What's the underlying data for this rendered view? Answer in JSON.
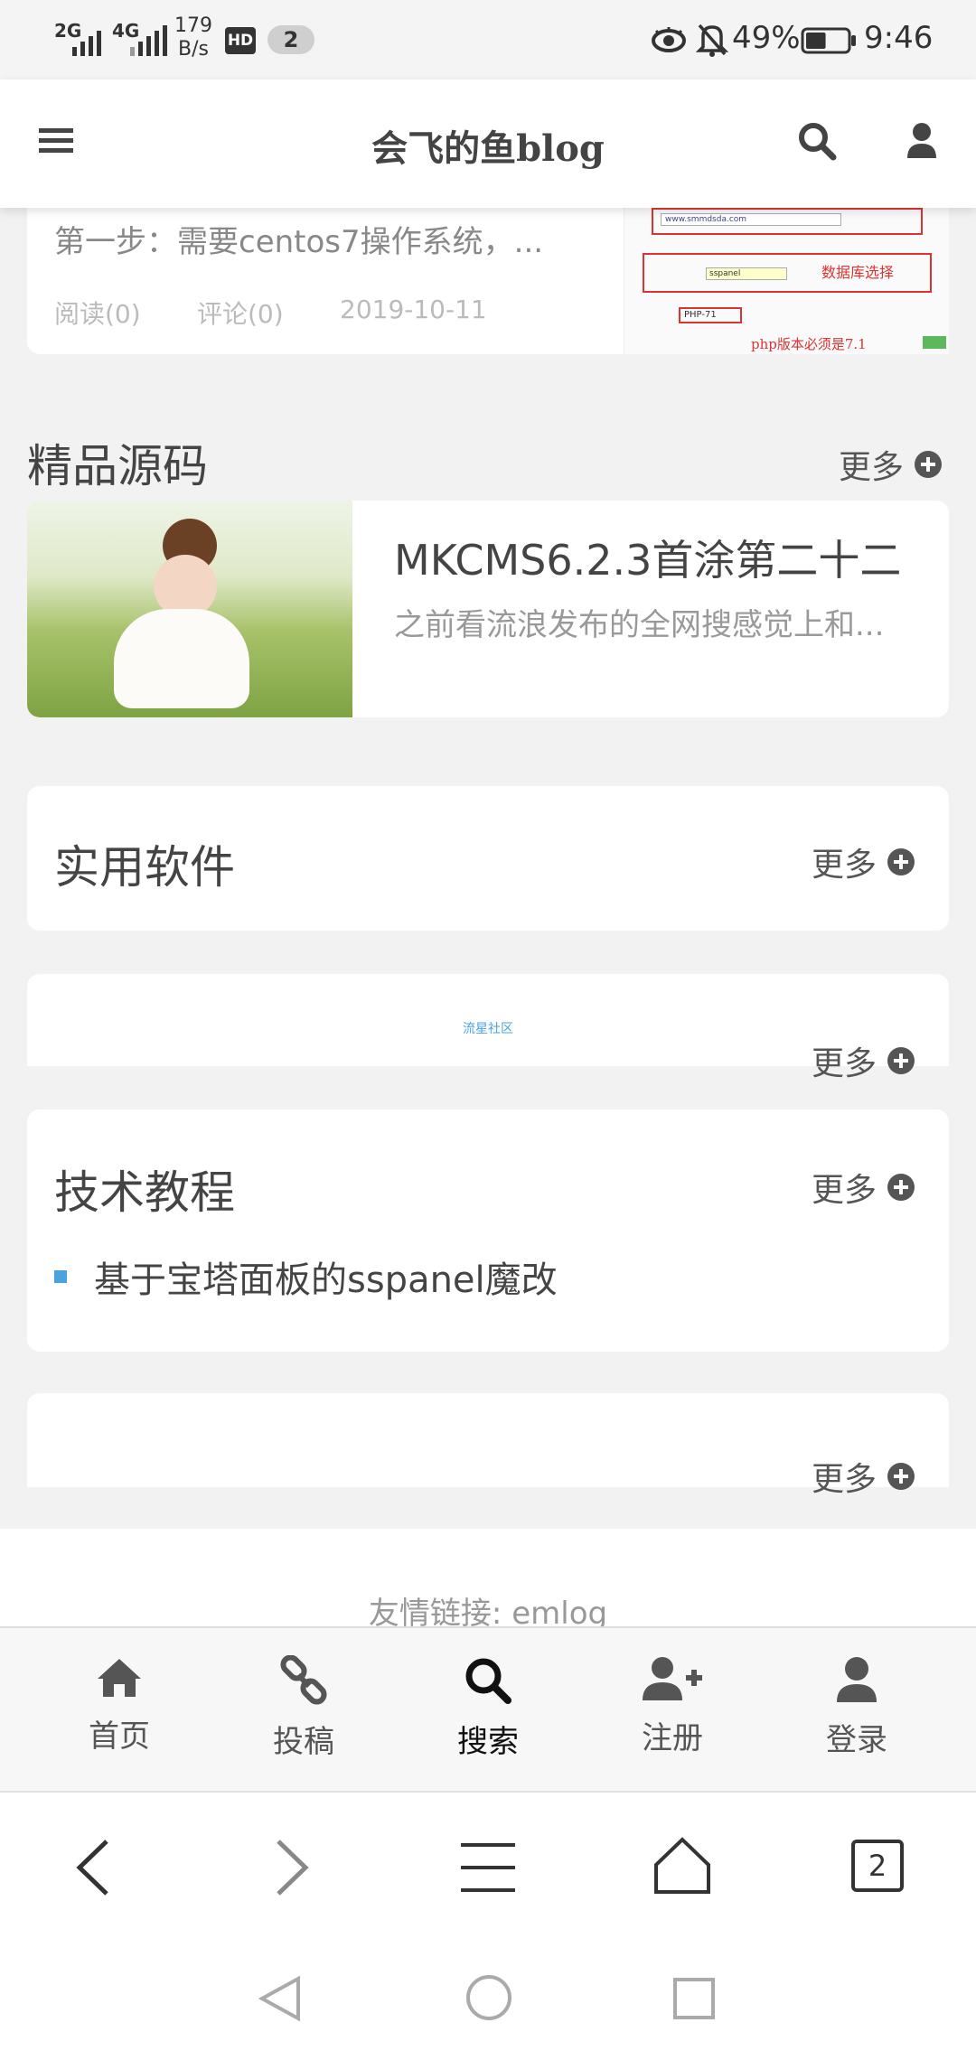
{
  "status_bar": {
    "signal1_label": "2G",
    "signal2_label": "4G",
    "net_speed_value": "179",
    "net_speed_unit": "B/s",
    "hd_badge": "HD",
    "notification_count": "2",
    "battery_percent": "49%",
    "time": "9:46",
    "battery_level": 0.49
  },
  "header": {
    "site_title": "会飞的鱼blog"
  },
  "top_post": {
    "excerpt": "第一步：需要centos7操作系统，...",
    "reads": "阅读(0)",
    "comments": "评论(0)",
    "date": "2019-10-11",
    "thumb_texts": {
      "db_label": "数据库选择",
      "php_label": "php版本必须是7.1",
      "db_field": "sspanel",
      "url_field": "www.smmdsda.com",
      "select_php": "PHP-71"
    }
  },
  "sections": {
    "premium_source": {
      "title": "精品源码",
      "more": "更多",
      "post_title": "MKCMS6.2.3首涂第二十二",
      "post_excerpt": "之前看流浪发布的全网搜感觉上和..."
    },
    "software": {
      "title": "实用软件",
      "more": "更多"
    },
    "ad_block": {
      "text": "流星社区",
      "more": "更多"
    },
    "tutorials": {
      "title": "技术教程",
      "more": "更多",
      "items": [
        "基于宝塔面板的sspanel魔改"
      ]
    },
    "empty_block": {
      "more": "更多"
    }
  },
  "footer": {
    "links_label": "友情链接:",
    "links": [
      "emlog"
    ]
  },
  "bottom_nav": {
    "items": [
      {
        "label": "首页",
        "icon": "home-icon"
      },
      {
        "label": "投稿",
        "icon": "link-icon"
      },
      {
        "label": "搜索",
        "icon": "search-icon"
      },
      {
        "label": "注册",
        "icon": "user-plus-icon"
      },
      {
        "label": "登录",
        "icon": "user-icon"
      }
    ],
    "active_index": 2
  },
  "browser_bar": {
    "tab_count": "2"
  },
  "colors": {
    "accent_blue": "#4aa3df",
    "text_dark": "#333333",
    "muted": "#bbbbbb"
  }
}
